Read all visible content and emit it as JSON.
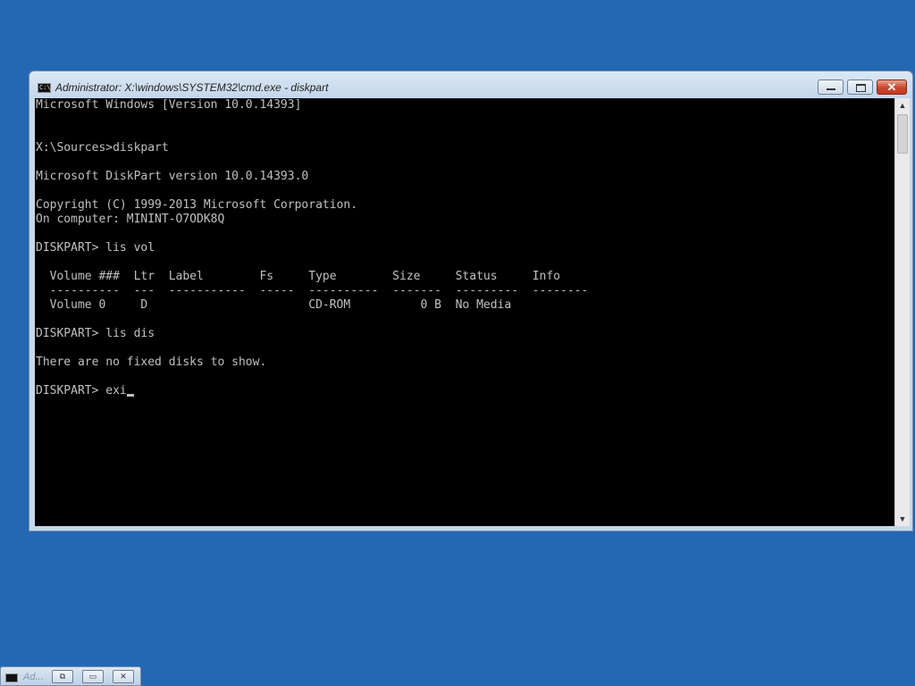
{
  "window": {
    "title": "Administrator: X:\\windows\\SYSTEM32\\cmd.exe - diskpart",
    "icon_text": "C:\\",
    "buttons": {
      "minimize": "minimize",
      "maximize": "maximize",
      "close": "✕"
    }
  },
  "console": {
    "lines": [
      "Microsoft Windows [Version 10.0.14393]",
      "",
      "",
      "X:\\Sources>diskpart",
      "",
      "Microsoft DiskPart version 10.0.14393.0",
      "",
      "Copyright (C) 1999-2013 Microsoft Corporation.",
      "On computer: MININT-O7ODK8Q",
      "",
      "DISKPART> lis vol",
      "",
      "  Volume ###  Ltr  Label        Fs     Type        Size     Status     Info",
      "  ----------  ---  -----------  -----  ----------  -------  ---------  --------",
      "  Volume 0     D                       CD-ROM          0 B  No Media",
      "",
      "DISKPART> lis dis",
      "",
      "There are no fixed disks to show.",
      ""
    ],
    "prompt_line": "DISKPART> exi"
  },
  "taskbar": {
    "label": "Ad...",
    "buttons": {
      "restore": "⧉",
      "maximize": "▭",
      "close": "✕"
    }
  },
  "colors": {
    "desktop": "#2467b3",
    "console_bg": "#000000",
    "console_fg": "#c0c0c0",
    "close_button": "#c8452c"
  },
  "icons": {
    "app": "cmd-icon",
    "scroll_up": "scroll-up-arrow-icon",
    "scroll_down": "scroll-down-arrow-icon"
  }
}
